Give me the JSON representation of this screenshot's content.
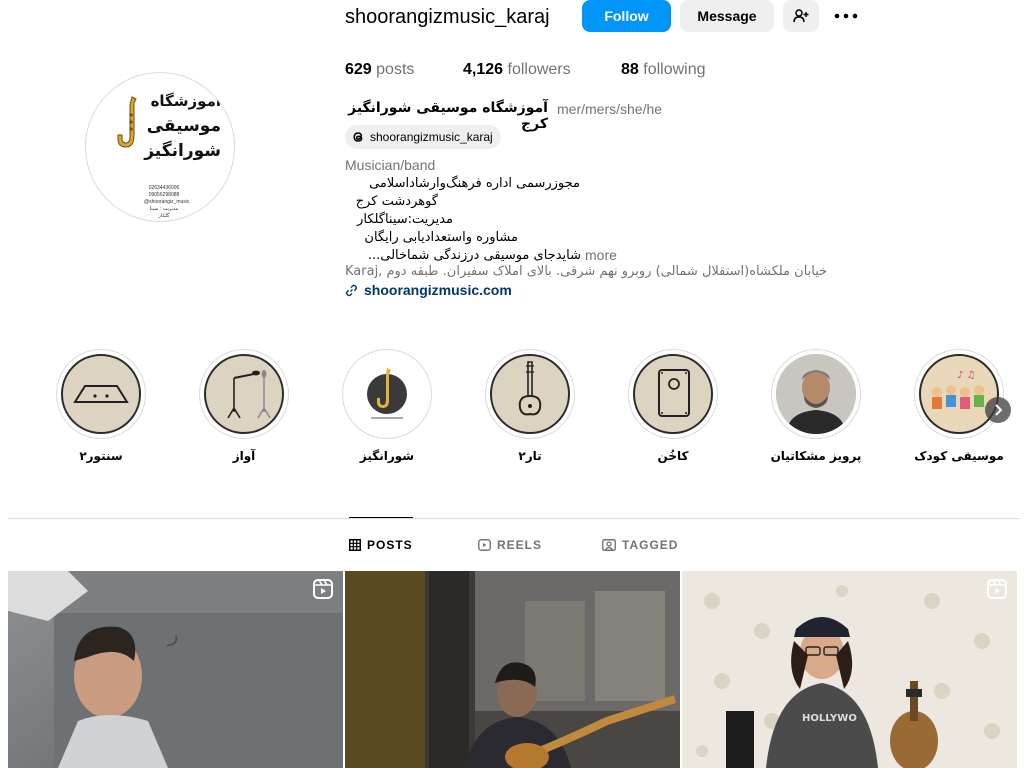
{
  "profile": {
    "username": "shoorangizmusic_karaj",
    "avatar_text_lines": [
      "آموزشگاه",
      "موسیقی",
      "شورانگیز"
    ],
    "avatar_small_lines": [
      "02634436006",
      "09056298088",
      "@shoorangiz_music",
      "مدیریت : سینا گلکار"
    ]
  },
  "actions": {
    "follow": "Follow",
    "message": "Message",
    "suggest_icon": "person-add-icon",
    "more_icon": "more-horizontal-icon"
  },
  "stats": {
    "posts_count": "629",
    "posts_label": "posts",
    "followers_count": "4,126",
    "followers_label": "followers",
    "following_count": "88",
    "following_label": "following"
  },
  "bio": {
    "full_name": "آموزشگاه موسیقی شورانگیز کرج",
    "pronouns": "mer/mers/she/he",
    "threads_handle": "shoorangizmusic_karaj",
    "category": "Musician/band",
    "lines": [
      "مجوزرسمی اداره فرهنگ‌وارشاداسلامی",
      "گوهردشت کرج",
      "مدیریت:سیناگلکار",
      "مشاوره واستعدادیابی رایگان",
      "شایدجای موسیقی درزندگی شماخالی..."
    ],
    "more": "more",
    "address_prefix": "Karaj, ",
    "address_fa": "خیابان ملکشاه(استقلال شمالی) روبرو نهم شرقی. بالای املاک سفیران. طبقه دوم",
    "link": "shoorangizmusic.com"
  },
  "highlights": [
    {
      "label": "سنتور۲",
      "icon": "santur-icon"
    },
    {
      "label": "آواز",
      "icon": "microphone-stand-icon"
    },
    {
      "label": "شورانگیز",
      "icon": "saxophone-logo-icon"
    },
    {
      "label": "تار۲",
      "icon": "tar-instrument-icon"
    },
    {
      "label": "کاخُن",
      "icon": "cajon-icon"
    },
    {
      "label": "پرویز مشکاتیان",
      "icon": "portrait-photo"
    },
    {
      "label": "موسیقی کودک",
      "icon": "kids-photo"
    }
  ],
  "tabs": [
    {
      "label": "POSTS",
      "icon": "grid-icon",
      "active": true
    },
    {
      "label": "REELS",
      "icon": "reels-icon",
      "active": false
    },
    {
      "label": "TAGGED",
      "icon": "tagged-icon",
      "active": false
    }
  ],
  "posts": [
    {
      "type": "reel",
      "badge_icon": "reel-badge-icon"
    },
    {
      "type": "photo"
    },
    {
      "type": "reel",
      "badge_icon": "reel-badge-icon"
    }
  ],
  "colors": {
    "accent": "#0095f6",
    "secondary_text": "#737373",
    "link": "#00376b",
    "highlight_fill": "#dcd3c1"
  }
}
